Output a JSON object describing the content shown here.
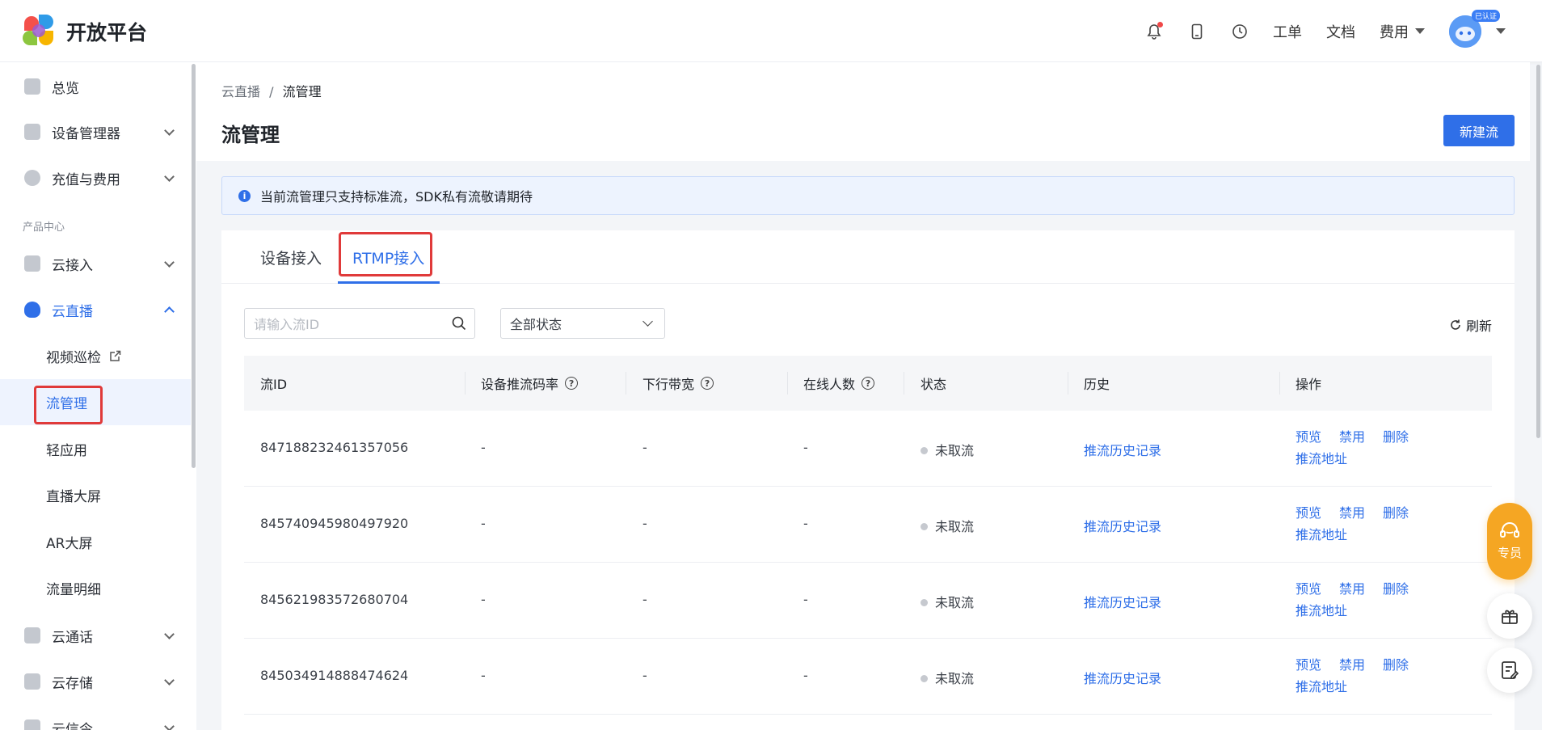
{
  "header": {
    "logo_text": "开放平台",
    "links": {
      "workorder": "工单",
      "docs": "文档",
      "fees": "费用"
    },
    "verified_badge": "已认证",
    "icons": [
      "bell-icon",
      "phone-icon",
      "clock-icon"
    ],
    "notification_dot_color": "#f04848"
  },
  "sidebar": {
    "overview": "总览",
    "device_manager": "设备管理器",
    "recharge": "充值与费用",
    "section_title": "产品中心",
    "cloud_access": "云接入",
    "cloud_live": "云直播",
    "sub": {
      "video_patrol": "视频巡检",
      "stream_mgmt": "流管理",
      "light_app": "轻应用",
      "live_screen": "直播大屏",
      "ar_screen": "AR大屏",
      "traffic_detail": "流量明细"
    },
    "cloud_call": "云通话",
    "cloud_storage": "云存储",
    "cloud_msg": "云信令"
  },
  "main": {
    "breadcrumb": {
      "parent": "云直播",
      "sep": "/",
      "current": "流管理"
    },
    "title": "流管理",
    "new_button": "新建流",
    "notice": "当前流管理只支持标准流，SDK私有流敬请期待",
    "tabs": [
      "设备接入",
      "RTMP接入"
    ],
    "active_tab": "RTMP接入",
    "search_placeholder": "请输入流ID",
    "status_select": "全部状态",
    "refresh": "刷新"
  },
  "table": {
    "columns": [
      "流ID",
      "设备推流码率",
      "下行带宽",
      "在线人数",
      "状态",
      "历史",
      "操作"
    ],
    "rows": [
      {
        "id": "847188232461357056",
        "bitrate": "-",
        "bandwidth": "-",
        "online": "-",
        "status": "未取流",
        "history": "推流历史记录",
        "actions": [
          "预览",
          "禁用",
          "删除",
          "推流地址"
        ]
      },
      {
        "id": "845740945980497920",
        "bitrate": "-",
        "bandwidth": "-",
        "online": "-",
        "status": "未取流",
        "history": "推流历史记录",
        "actions": [
          "预览",
          "禁用",
          "删除",
          "推流地址"
        ]
      },
      {
        "id": "845621983572680704",
        "bitrate": "-",
        "bandwidth": "-",
        "online": "-",
        "status": "未取流",
        "history": "推流历史记录",
        "actions": [
          "预览",
          "禁用",
          "删除",
          "推流地址"
        ]
      },
      {
        "id": "845034914888474624",
        "bitrate": "-",
        "bandwidth": "-",
        "online": "-",
        "status": "未取流",
        "history": "推流历史记录",
        "actions": [
          "预览",
          "禁用",
          "删除",
          "推流地址"
        ]
      }
    ]
  },
  "floating": {
    "support_label": "专员"
  },
  "colors": {
    "accent": "#2f6fe8",
    "highlight_box": "#e03a3a",
    "support": "#f5a623"
  }
}
